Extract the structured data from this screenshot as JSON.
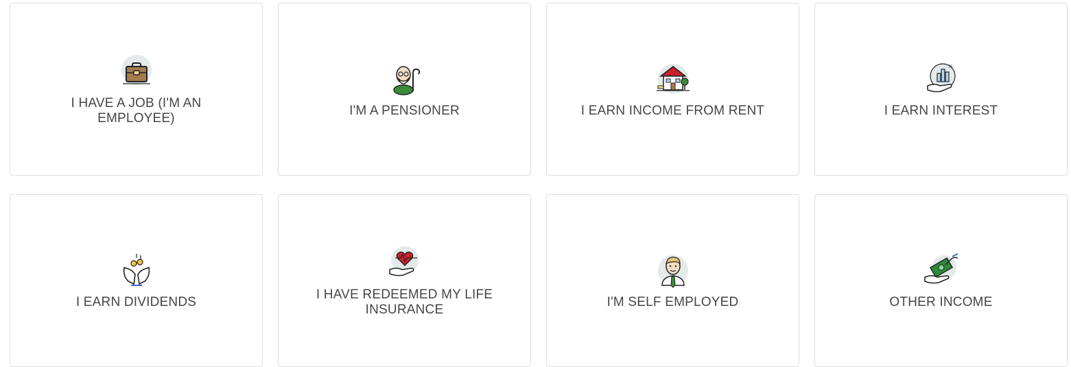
{
  "income_options": [
    {
      "label": "I HAVE A JOB (I'M AN EMPLOYEE)",
      "icon": "briefcase-icon"
    },
    {
      "label": "I'M A PENSIONER",
      "icon": "pensioner-icon"
    },
    {
      "label": "I EARN INCOME FROM RENT",
      "icon": "house-icon"
    },
    {
      "label": "I EARN INTEREST",
      "icon": "interest-hand-icon"
    },
    {
      "label": "I EARN DIVIDENDS",
      "icon": "dividends-hands-icon"
    },
    {
      "label": "I HAVE REDEEMED MY LIFE INSURANCE",
      "icon": "heart-hand-icon"
    },
    {
      "label": "I'M SELF EMPLOYED",
      "icon": "businessman-icon"
    },
    {
      "label": "OTHER INCOME",
      "icon": "cash-hand-icon"
    }
  ],
  "colors": {
    "card_border": "#dedede",
    "label_text": "#454545",
    "icon_bg": "#dfe6e6",
    "briefcase": "#a57c4e",
    "roof_red": "#c8202e",
    "tree_green": "#3c8a3c",
    "heart_red": "#c8202e",
    "cash_green": "#2e8b3a"
  }
}
